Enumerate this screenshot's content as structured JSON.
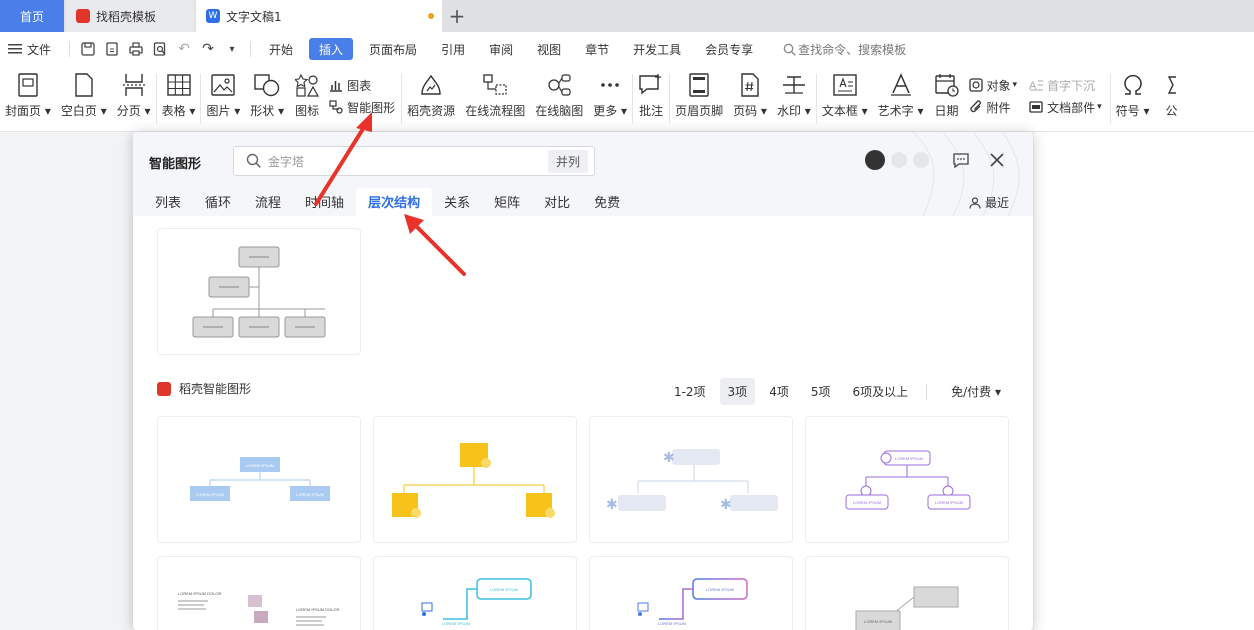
{
  "tabs": {
    "home": "首页",
    "template": "找稻壳模板",
    "doc": "文字文稿1",
    "doc_icon": "W"
  },
  "menubar": {
    "file": "文件",
    "items": [
      "开始",
      "插入",
      "页面布局",
      "引用",
      "审阅",
      "视图",
      "章节",
      "开发工具",
      "会员专享"
    ],
    "active": "插入",
    "search": "查找命令、搜索模板"
  },
  "ribbon": {
    "cover": "封面页",
    "blank": "空白页",
    "pagebreak": "分页",
    "table": "表格",
    "picture": "图片",
    "shape": "形状",
    "icon": "图标",
    "chart": "图表",
    "smartart": "智能图形",
    "docer": "稻壳资源",
    "flowchart": "在线流程图",
    "mindmap": "在线脑图",
    "more": "更多",
    "comment": "批注",
    "headerfooter": "页眉页脚",
    "pagenum": "页码",
    "watermark": "水印",
    "textbox": "文本框",
    "wordart": "艺术字",
    "date": "日期",
    "object": "对象",
    "attachment": "附件",
    "dropcap": "首字下沉",
    "docpart": "文档部件",
    "symbol": "符号",
    "formula": "公"
  },
  "dialog": {
    "title": "智能图形",
    "search_placeholder": "金字塔",
    "search_mode": "并列",
    "categories": [
      "列表",
      "循环",
      "流程",
      "时间轴",
      "层次结构",
      "关系",
      "矩阵",
      "对比",
      "免费"
    ],
    "active_category": "层次结构",
    "recent": "最近",
    "section_title": "稻壳智能图形",
    "filters": [
      "1-2项",
      "3项",
      "4项",
      "5项",
      "6项及以上"
    ],
    "active_filter": "3项",
    "price_filter": "免/付费",
    "thumb_text": "LOREM IPSUM",
    "thumb_text2": "LOREM IPSUM DOLOR",
    "thumb_text3": "Lorem ipsum dolor sit amet, consectetur adipiscing elit"
  },
  "colors": {
    "accent": "#2f6fe4",
    "tab_home": "#4a7ee8",
    "arrow": "#e8322a",
    "docer_red": "#e0352b",
    "yellow": "#f7c31a",
    "purple": "#9b6ee0",
    "light_blue": "#9dc3ee"
  }
}
